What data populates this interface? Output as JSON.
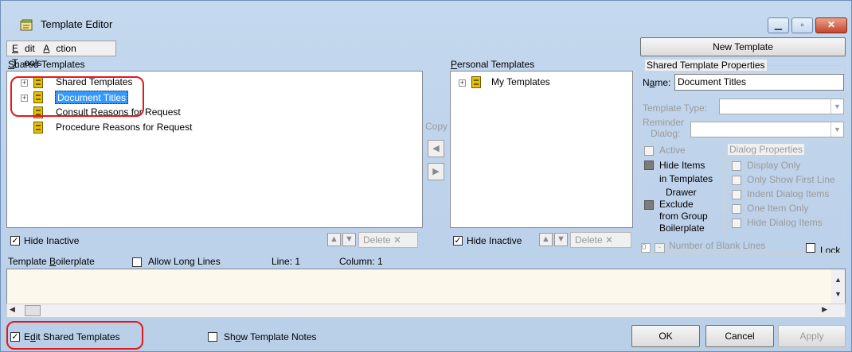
{
  "window": {
    "title": "Template Editor",
    "caption_buttons": [
      "minimize-icon",
      "maximize-icon",
      "close-icon"
    ]
  },
  "menu": [
    "Edit",
    "Action",
    "Tools"
  ],
  "new_template_label": "New Template",
  "shared": {
    "header": "Shared Templates",
    "tree": [
      "Shared Templates",
      "Document Titles",
      "Consult Reasons for Request",
      "Procedure Reasons for Request"
    ],
    "hide_inactive": "Hide Inactive",
    "delete_label": "Delete"
  },
  "copy_label": "Copy",
  "personal": {
    "header": "Personal Templates",
    "tree": [
      "My Templates"
    ],
    "hide_inactive": "Hide Inactive",
    "delete_label": "Delete"
  },
  "props": {
    "header": "Shared Template Properties",
    "name_label": "Name:",
    "name_value": "Document Titles",
    "template_type_label": "Template Type:",
    "reminder_label": "Reminder",
    "dialog_label": "Dialog:",
    "active_label": "Active",
    "hide_items": [
      "Hide Items",
      "in Templates",
      "Drawer"
    ],
    "exclude": [
      "Exclude",
      "from Group",
      "Boilerplate"
    ],
    "dialog_props_header": "Dialog Properties",
    "dialog_props": [
      "Display Only",
      "Only Show First Line",
      "Indent Dialog Items",
      "One Item Only",
      "Hide Dialog Items"
    ],
    "number_blank_lines": "Number of Blank Lines",
    "blank_lines_value": "0",
    "lock_label": "Lock"
  },
  "boilerplate": {
    "label": "Template Boilerplate",
    "allow_long_lines": "Allow Long Lines",
    "line": "Line: 1",
    "column": "Column: 1"
  },
  "bottom": {
    "edit_shared": "Edit Shared Templates",
    "show_notes": "Show Template Notes",
    "ok": "OK",
    "cancel": "Cancel",
    "apply": "Apply"
  },
  "colors": {
    "annotation": "#e8161e",
    "selection": "#3399ff",
    "boilerplate_bg": "#fdf8ec"
  }
}
